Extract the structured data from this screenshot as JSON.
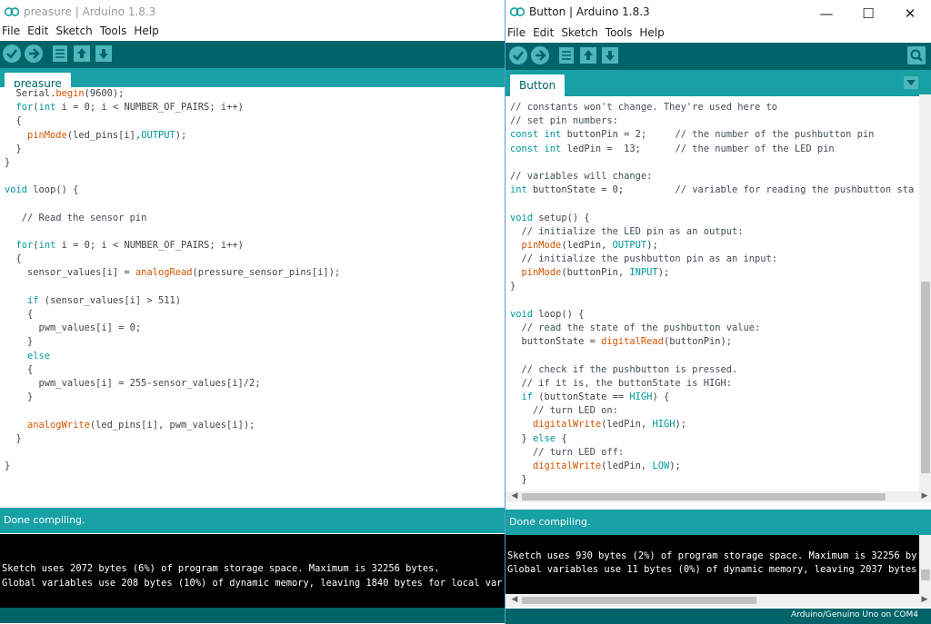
{
  "colors": {
    "toolbar_dark": "#006468",
    "teal": "#17a1a5",
    "keyword": "#00979c",
    "function": "#d35400",
    "comment": "#434f54"
  },
  "window1": {
    "title": "preasure | Arduino 1.8.3",
    "menu": [
      "File",
      "Edit",
      "Sketch",
      "Tools",
      "Help"
    ],
    "toolbar_icons": [
      "verify-icon",
      "upload-icon",
      "new-icon",
      "open-icon",
      "save-icon"
    ],
    "tab": "preasure",
    "code_lines": [
      "  Serial.begin(9600);",
      "  for(int i = 0; i < NUMBER_OF_PAIRS; i++)",
      "  {",
      "    pinMode(led_pins[i],OUTPUT);",
      "  }",
      "}",
      "",
      "void loop() {",
      "",
      "   // Read the sensor pin",
      "",
      "  for(int i = 0; i < NUMBER_OF_PAIRS; i++)",
      "  {",
      "    sensor_values[i] = analogRead(pressure_sensor_pins[i]);",
      "",
      "    if (sensor_values[i] > 511)",
      "    {",
      "      pwm_values[i] = 0;",
      "    }",
      "    else",
      "    {",
      "      pwm_values[i] = 255-sensor_values[i]/2;",
      "    }",
      "",
      "    analogWrite(led_pins[i], pwm_values[i]);",
      "  }",
      "",
      "}"
    ],
    "status": "Done compiling.",
    "console_lines": [
      "",
      "",
      "Sketch uses 2072 bytes (6%) of program storage space. Maximum is 32256 bytes.",
      "Global variables use 208 bytes (10%) of dynamic memory, leaving 1840 bytes for local var"
    ]
  },
  "window2": {
    "title": "Button | Arduino 1.8.3",
    "menu": [
      "File",
      "Edit",
      "Sketch",
      "Tools",
      "Help"
    ],
    "toolbar_icons": [
      "verify-icon",
      "upload-icon",
      "new-icon",
      "open-icon",
      "save-icon"
    ],
    "serial_monitor_icon": "serial-monitor-icon",
    "tab": "Button",
    "code_lines": [
      "// constants won't change. They're used here to",
      "// set pin numbers:",
      "const int buttonPin = 2;     // the number of the pushbutton pin",
      "const int ledPin =  13;      // the number of the LED pin",
      "",
      "// variables will change:",
      "int buttonState = 0;         // variable for reading the pushbutton sta",
      "",
      "void setup() {",
      "  // initialize the LED pin as an output:",
      "  pinMode(ledPin, OUTPUT);",
      "  // initialize the pushbutton pin as an input:",
      "  pinMode(buttonPin, INPUT);",
      "}",
      "",
      "void loop() {",
      "  // read the state of the pushbutton value:",
      "  buttonState = digitalRead(buttonPin);",
      "",
      "  // check if the pushbutton is pressed.",
      "  // if it is, the buttonState is HIGH:",
      "  if (buttonState == HIGH) {",
      "    // turn LED on:",
      "    digitalWrite(ledPin, HIGH);",
      "  } else {",
      "    // turn LED off:",
      "    digitalWrite(ledPin, LOW);",
      "  }"
    ],
    "status": "Done compiling.",
    "console_lines": [
      "",
      "Sketch uses 930 bytes (2%) of program storage space. Maximum is 32256 by",
      "Global variables use 11 bytes (0%) of dynamic memory, leaving 2037 bytes"
    ],
    "board": "Arduino/Genuino Uno on COM4",
    "window_controls": {
      "minimize": "—",
      "maximize": "☐",
      "close": "✕"
    }
  }
}
